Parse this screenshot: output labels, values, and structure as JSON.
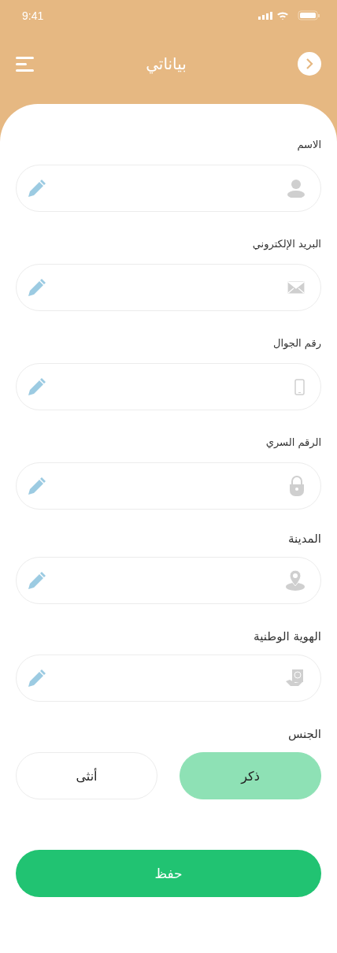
{
  "status_bar": {
    "time": "9:41"
  },
  "header": {
    "title": "بياناتي"
  },
  "fields": [
    {
      "label": "الاسم",
      "kind": "person"
    },
    {
      "label": "البريد الإلكتروني",
      "kind": "mail"
    },
    {
      "label": "رقم الجوال",
      "kind": "phone"
    },
    {
      "label": "الرقم السري",
      "kind": "lock"
    },
    {
      "label": "المدينة",
      "kind": "location"
    },
    {
      "label": "الهوية الوطنية",
      "kind": "id"
    }
  ],
  "gender": {
    "label": "الجنس",
    "options": [
      {
        "label": "ذكر",
        "selected": true
      },
      {
        "label": "أنثى",
        "selected": false
      }
    ]
  },
  "save_button": "حفظ"
}
